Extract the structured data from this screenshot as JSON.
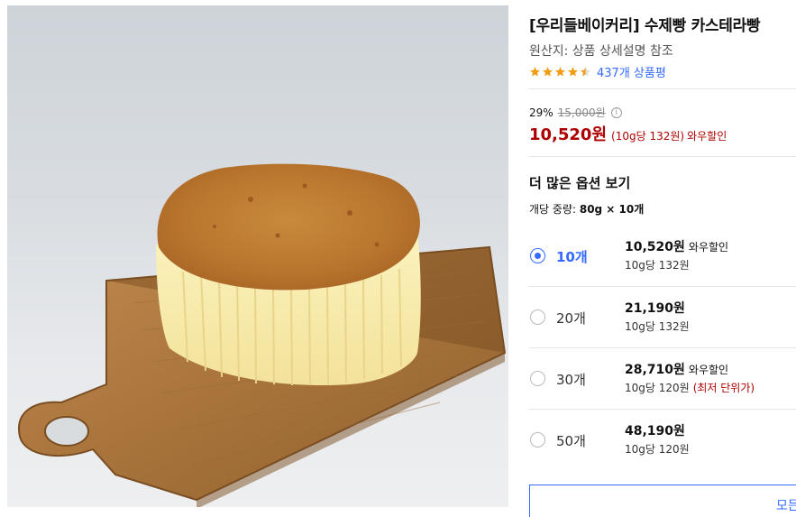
{
  "product": {
    "title": "[우리들베이커리] 수제빵 카스테라빵",
    "origin": "원산지: 상품 상세설명 참조",
    "image_icon": "castella-photo",
    "rating_out_of_5": 4.5,
    "review_count": "437개 상품평"
  },
  "price": {
    "discount_rate": "29%",
    "original_price": "15,000원",
    "info_icon": "i",
    "sale_price": "10,520원",
    "unit_price": "(10g당 132원)",
    "wow_label": "와우할인"
  },
  "options": {
    "more_label": "더 많은 옵션 보기",
    "unit_spec_prefix": "개당 중량: ",
    "unit_spec_value": "80g × 10개",
    "items": [
      {
        "qty": "10개",
        "price": "10,520원",
        "wow": "와우할인",
        "unit": "10g당 132원",
        "note": "",
        "selected": true
      },
      {
        "qty": "20개",
        "price": "21,190원",
        "wow": "",
        "unit": "10g당 132원",
        "note": "",
        "selected": false
      },
      {
        "qty": "30개",
        "price": "28,710원",
        "wow": "와우할인",
        "unit": "10g당 120원",
        "note": "(최저 단위가)",
        "selected": false
      },
      {
        "qty": "50개",
        "price": "48,190원",
        "wow": "",
        "unit": "10g당 120원",
        "note": "",
        "selected": false
      }
    ],
    "all_button_label": "모든"
  },
  "colors": {
    "accent_blue": "#346aff",
    "price_red": "#ae0000",
    "star_orange": "#f39c12"
  }
}
